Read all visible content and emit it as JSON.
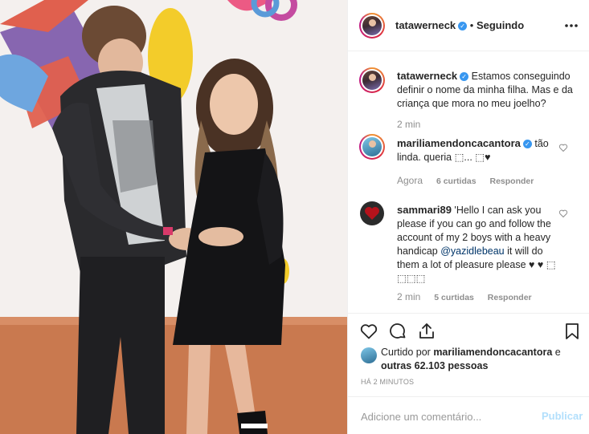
{
  "post": {
    "author": "tatawerneck",
    "follow_status": "Seguindo",
    "more_icon": "more-horizontal-icon",
    "caption_author": "tatawerneck",
    "caption_text": "Estamos conseguindo definir o nome da minha filha. Mas e da criança que mora no meu joelho?",
    "caption_time": "2 min",
    "verified_symbol": "✓",
    "colors": {
      "accent": "#3897f0",
      "link": "#003569",
      "muted": "#8e8e8e"
    }
  },
  "comments": [
    {
      "author": "mariliamendoncacantora",
      "verified": true,
      "text": "tão linda. queria ⬚... ⬚♥",
      "time": "Agora",
      "likes": "6 curtidas",
      "reply": "Responder"
    },
    {
      "author": "sammari89",
      "verified": false,
      "text_before": " 'Hello I can ask you please if you can go and follow the account of my 2 boys with a heavy handicap ",
      "mention": "@yazidlebeau",
      "text_after": " it will do them a lot of pleasure please ♥ ♥ ⬚ ⬚⬚⬚",
      "time": "2 min",
      "likes": "5 curtidas",
      "reply": "Responder"
    }
  ],
  "actions": {
    "icons": [
      "heart-icon",
      "comment-icon",
      "share-icon",
      "bookmark-icon"
    ],
    "liked_by_prefix": "Curtido por ",
    "liked_by_user": "mariliamendoncacantora",
    "liked_by_suffix": " e",
    "liked_by_others": "outras 62.103 pessoas",
    "timestamp": "HÁ 2 MINUTOS"
  },
  "add_comment": {
    "placeholder": "Adicione um comentário...",
    "publish_label": "Publicar"
  }
}
